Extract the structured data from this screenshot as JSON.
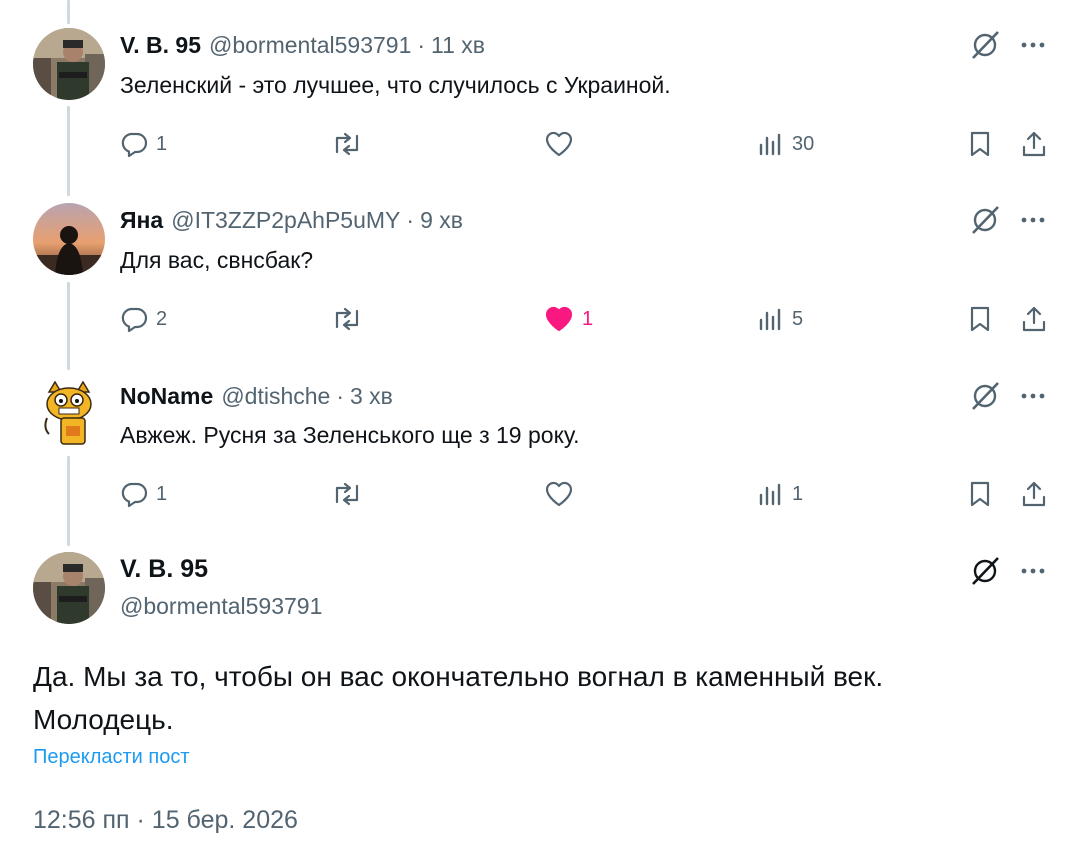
{
  "replies": [
    {
      "name": "V. B. 95",
      "handle": "@bormental593791",
      "separator": "·",
      "time": "11 хв",
      "text": "Зеленский - это лучшее, что случилось с Украиной.",
      "replies_count": "1",
      "reposts_count": "",
      "likes_count": "",
      "liked": false,
      "views_count": "30",
      "avatar_icon": "soldier-photo-avatar"
    },
    {
      "name": "Яна",
      "handle": "@IT3ZZP2pAhP5uMY",
      "separator": "·",
      "time": "9 хв",
      "text": "Для вас, свнсбак?",
      "replies_count": "2",
      "reposts_count": "",
      "likes_count": "1",
      "liked": true,
      "views_count": "5",
      "avatar_icon": "sunset-silhouette-avatar"
    },
    {
      "name": "NoName",
      "handle": "@dtishche",
      "separator": "·",
      "time": "3 хв",
      "text": "Авжеж. Русня за Зеленського ще з 19 року.",
      "replies_count": "1",
      "reposts_count": "",
      "likes_count": "",
      "liked": false,
      "views_count": "1",
      "avatar_icon": "cartoon-cat-avatar"
    }
  ],
  "focused": {
    "name": "V. B. 95",
    "handle": "@bormental593791",
    "text_line1": "Да. Мы за то, чтобы он вас окончательно вогнал в каменный век.",
    "text_line2": "Молодець.",
    "translate_label": "Перекласти пост",
    "timestamp": "12:56 пп · 15 бер. 2026"
  },
  "colors": {
    "text": "#0f1419",
    "secondary": "#536471",
    "like_active": "#f91880",
    "link": "#1d9bf0",
    "thread_line": "#cfd9de"
  }
}
